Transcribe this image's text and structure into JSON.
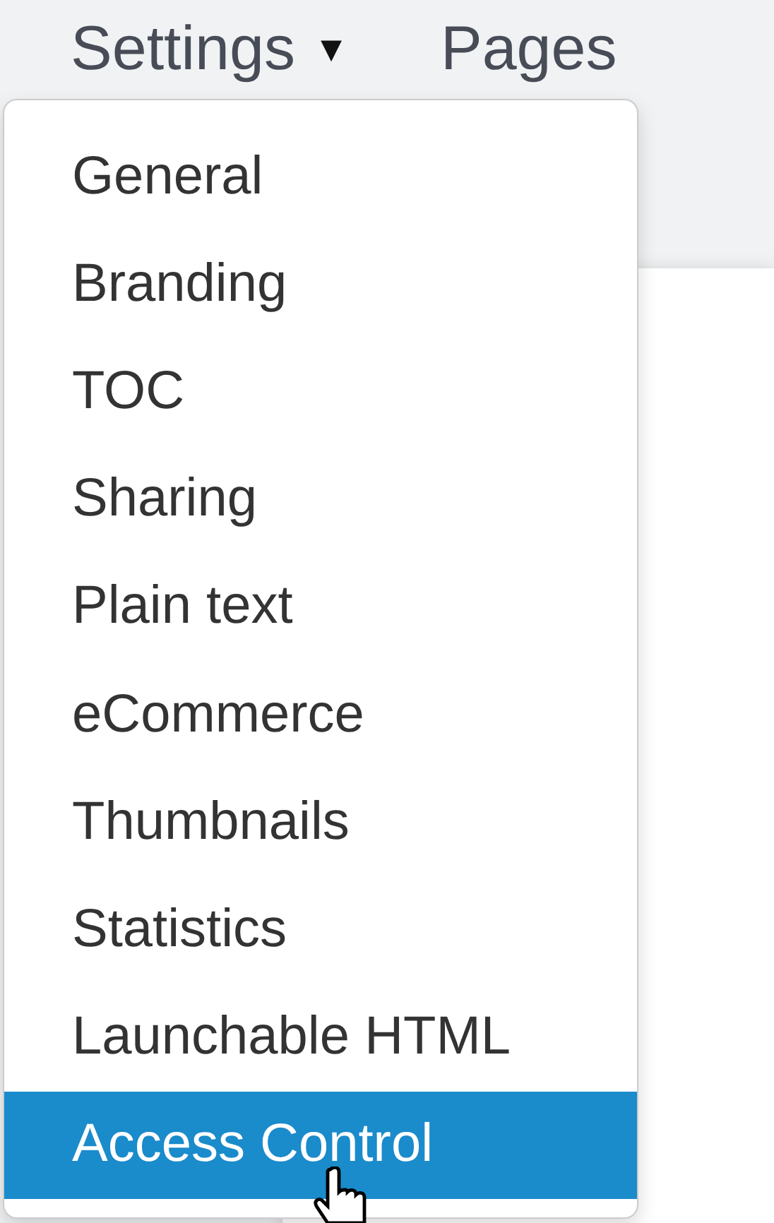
{
  "nav": [
    {
      "label": "Settings",
      "kind": "dropdown",
      "caret": "▾"
    },
    {
      "label": "Pages",
      "kind": "link"
    }
  ],
  "menu": {
    "items": [
      {
        "label": "General",
        "selected": false
      },
      {
        "label": "Branding",
        "selected": false
      },
      {
        "label": "TOC",
        "selected": false
      },
      {
        "label": "Sharing",
        "selected": false
      },
      {
        "label": "Plain text",
        "selected": false
      },
      {
        "label": "eCommerce",
        "selected": false
      },
      {
        "label": "Thumbnails",
        "selected": false
      },
      {
        "label": "Statistics",
        "selected": false
      },
      {
        "label": "Launchable HTML",
        "selected": false
      },
      {
        "label": "Access Control",
        "selected": true
      }
    ]
  }
}
